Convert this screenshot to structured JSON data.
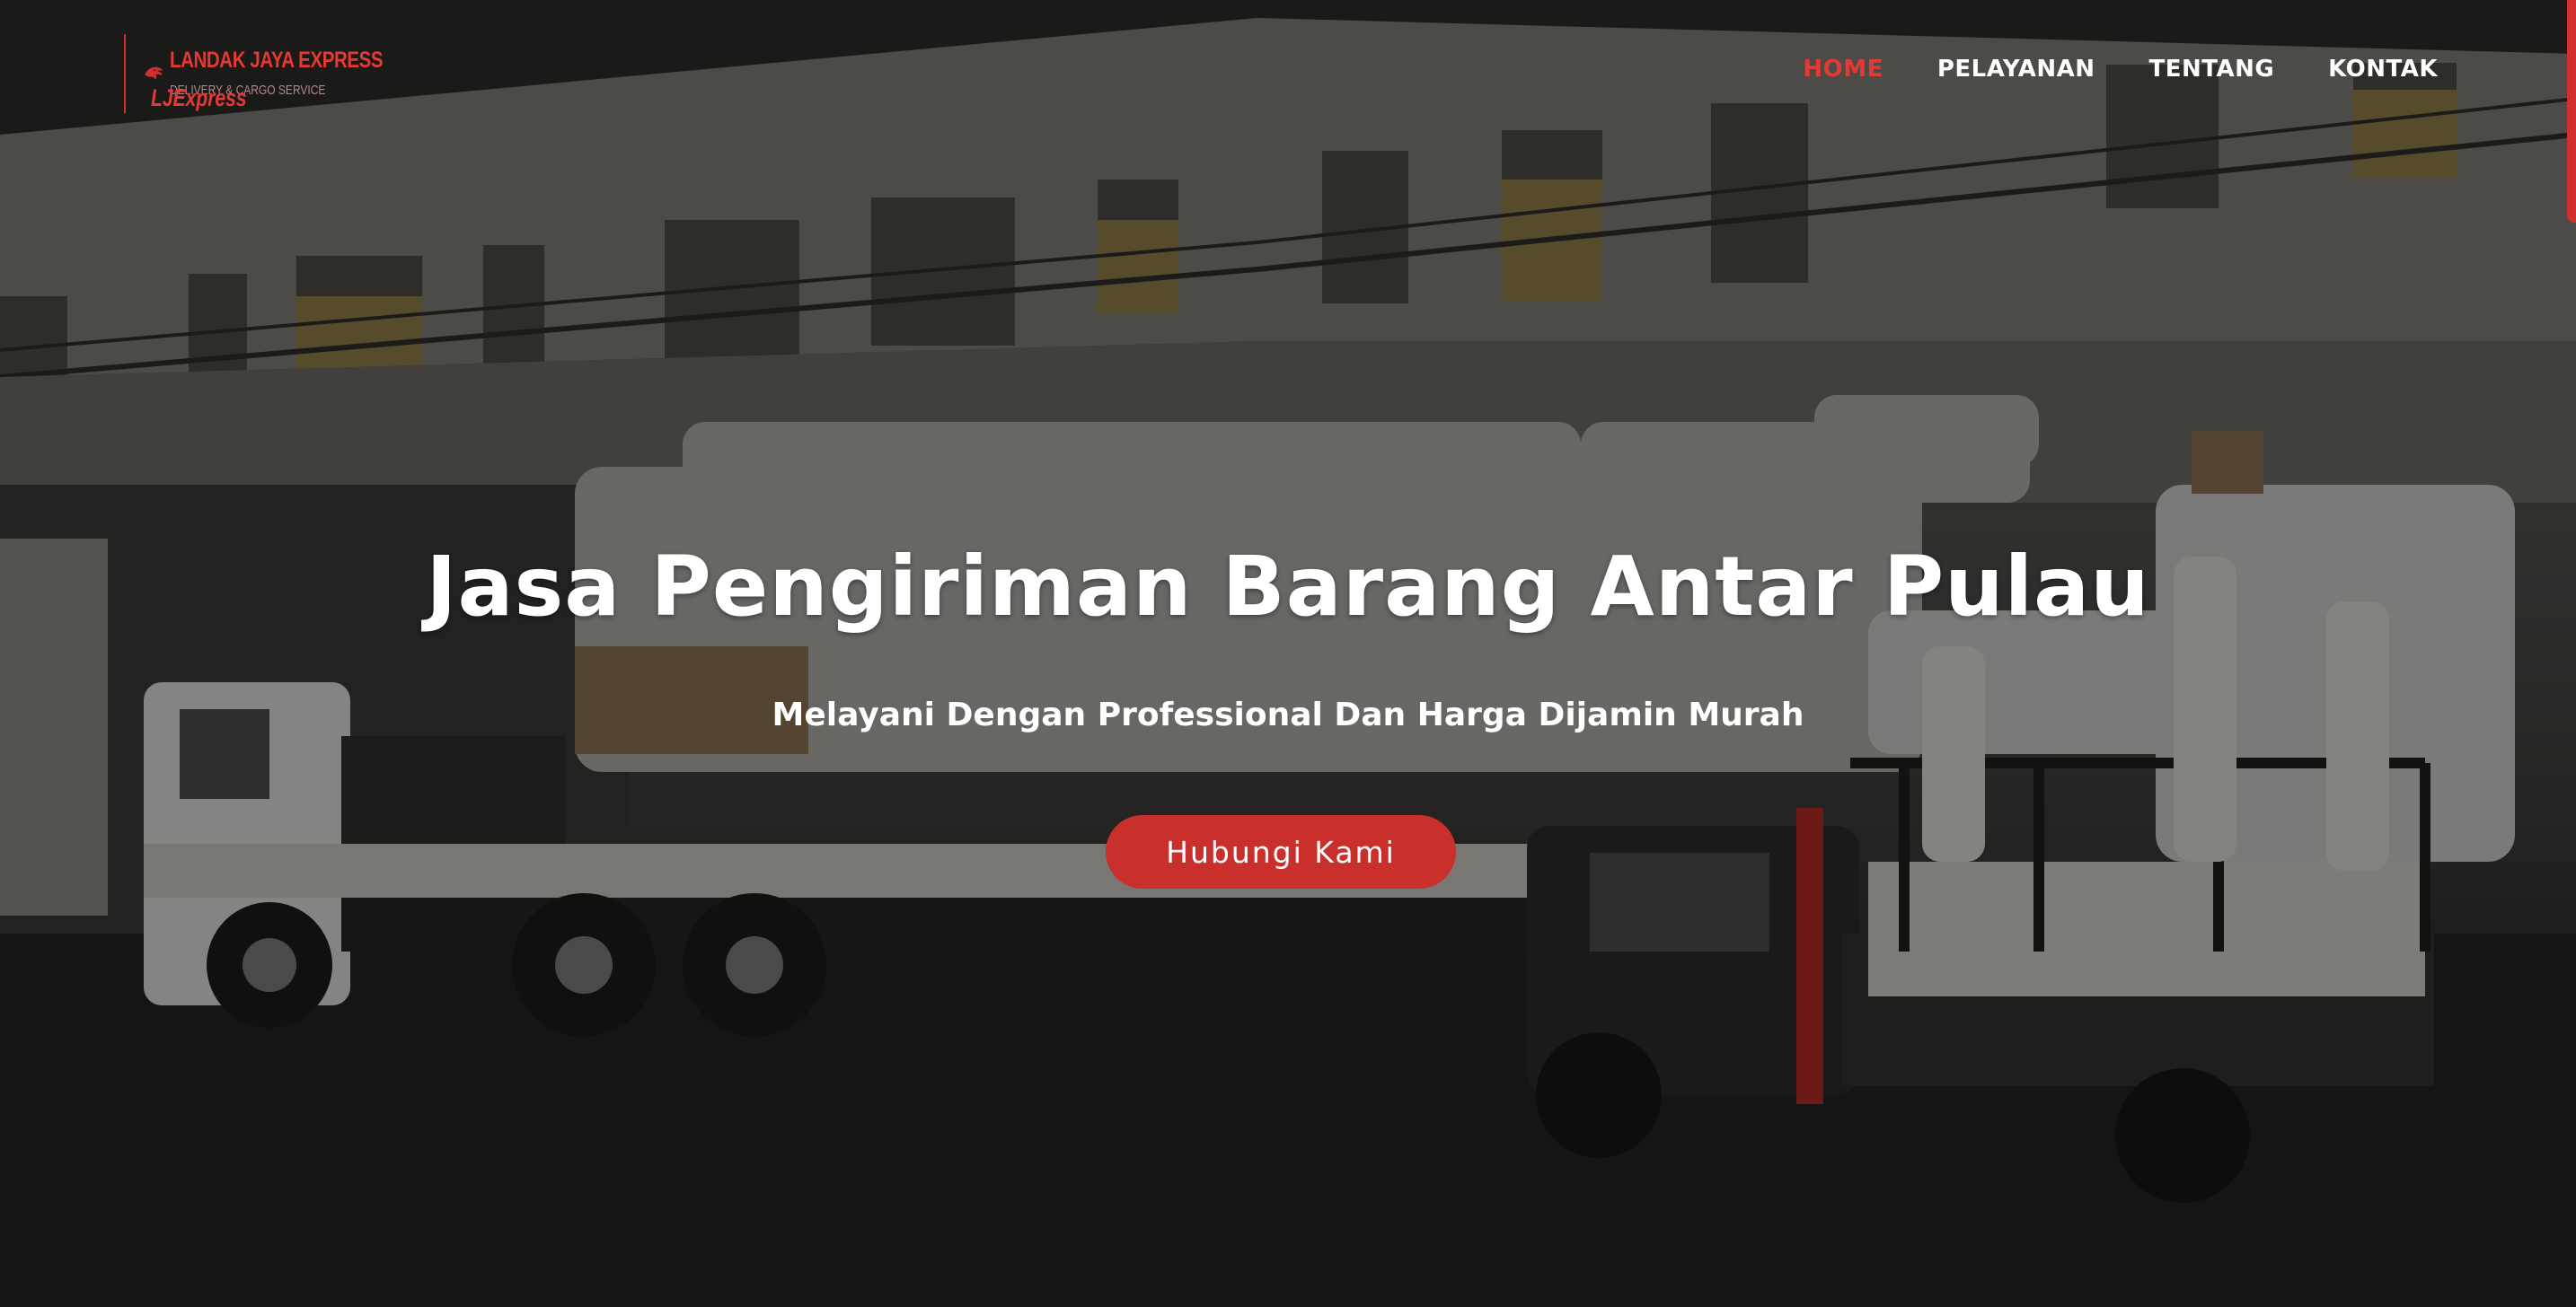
{
  "logo": {
    "title": "LANDAK JAYA EXPRESS",
    "subtitle": "DELIVERY & CARGO SERVICE",
    "brand": "LJExpress",
    "accent_color": "#e53935"
  },
  "nav": {
    "items": [
      {
        "label": "HOME",
        "active": true
      },
      {
        "label": "PELAYANAN",
        "active": false
      },
      {
        "label": "TENTANG",
        "active": false
      },
      {
        "label": "KONTAK",
        "active": false
      }
    ]
  },
  "hero": {
    "title": "Jasa Pengiriman Barang Antar Pulau",
    "subtitle": "Melayani Dengan Professional Dan Harga Dijamin Murah",
    "cta_label": "Hubungi Kami",
    "cta_color": "#c9302c"
  },
  "icons": {
    "logo": "eagle-logo-icon"
  }
}
